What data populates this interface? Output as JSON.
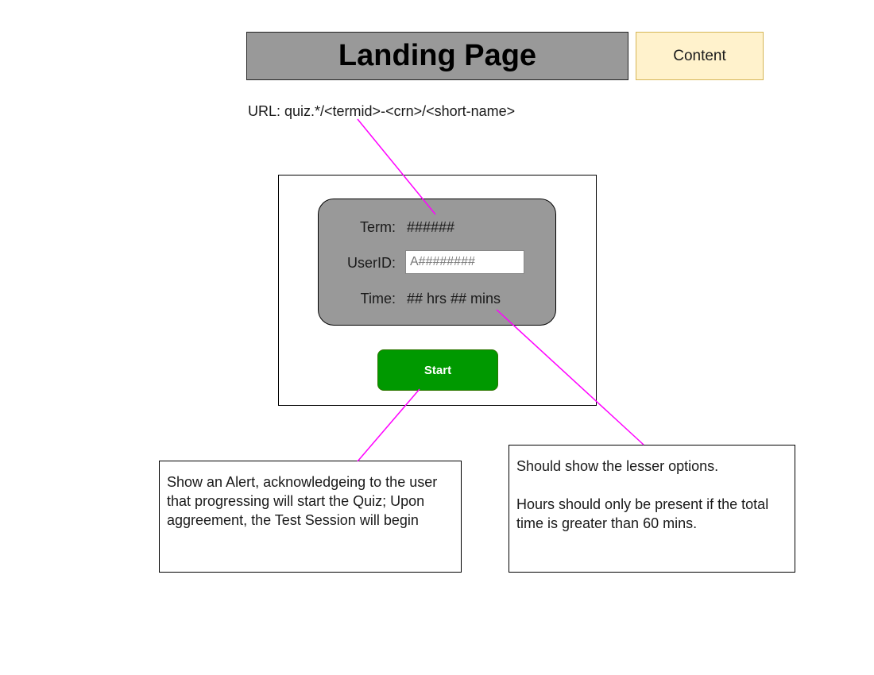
{
  "header": {
    "title": "Landing Page",
    "tag": "Content"
  },
  "url_label": "URL: quiz.*/<termid>-<crn>/<short-name>",
  "form": {
    "term_label": "Term:",
    "term_value": "######",
    "userid_label": "UserID:",
    "userid_placeholder": "A########",
    "time_label": "Time:",
    "time_value": "## hrs ## mins"
  },
  "start_button": "Start",
  "notes": {
    "start_note": "Show an Alert, acknowledgeing to the user that progressing will start the Quiz; Upon aggreement, the Test Session will begin",
    "time_note_line1": "Should show the lesser options.",
    "time_note_line2": "Hours should only be present if the total time is greater than 60 mins."
  },
  "colors": {
    "connector": "#ff00ff",
    "start_button": "#009900",
    "tag_fill": "#fff2cc",
    "card_fill": "#999999"
  }
}
